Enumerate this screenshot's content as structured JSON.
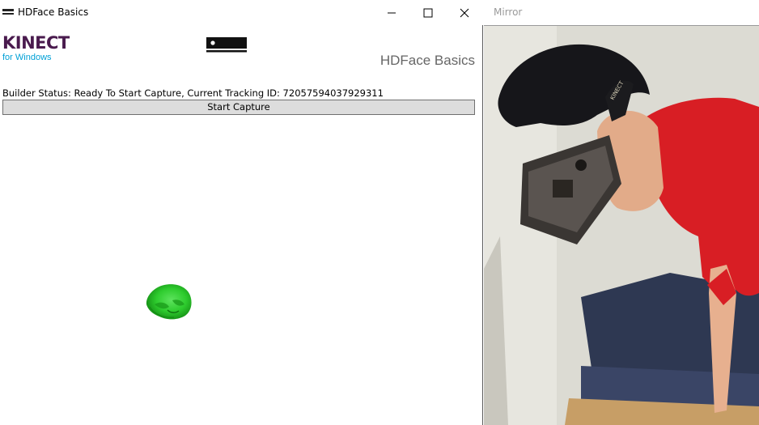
{
  "left_window": {
    "title": "HDFace Basics",
    "logo": {
      "brand": "KINECT",
      "sub": "for Windows"
    },
    "heading": "HDFace Basics",
    "status_text": "Builder Status: Ready To Start Capture, Current Tracking ID: 72057594037929311",
    "capture_button_label": "Start Capture",
    "icons": [
      "app-icon",
      "minimize-icon",
      "maximize-icon",
      "close-icon",
      "sensor-icon"
    ],
    "face_mesh_color": "#2ecc2e"
  },
  "right_window": {
    "title": "Mirror"
  },
  "colors": {
    "kinect_purple": "#4a1b4e",
    "kinect_blue": "#00a0d6",
    "button_bg": "#dddddd",
    "shirt_red": "#d81e24"
  }
}
